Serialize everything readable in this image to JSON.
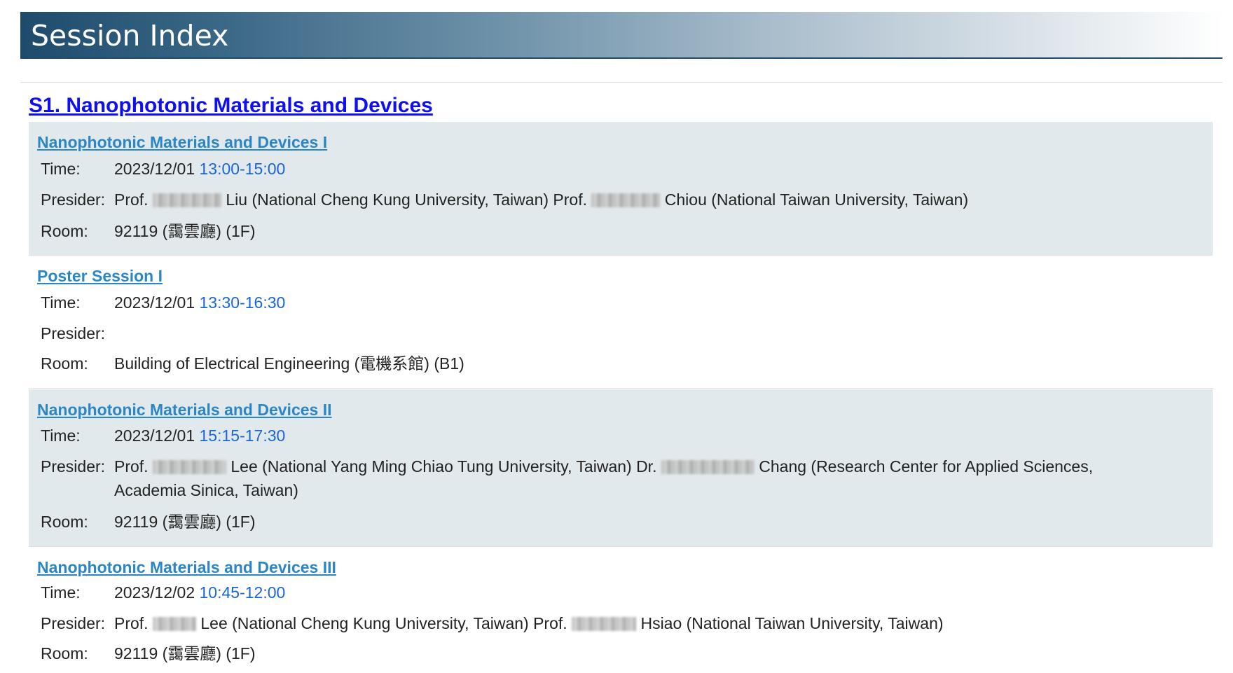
{
  "header": {
    "title": "Session Index"
  },
  "section": {
    "title": "S1. Nanophotonic Materials and Devices"
  },
  "labels": {
    "time": "Time:",
    "presider": "Presider:",
    "room": "Room:"
  },
  "sessions": [
    {
      "title": "Nanophotonic Materials and Devices I",
      "date": "2023/12/01",
      "time": "13:00-15:00",
      "presider": {
        "p1_title": "Prof.",
        "p1_mid": "Liu (National Cheng Kung University, Taiwan) Prof.",
        "p1_end": "Chiou (National Taiwan University, Taiwan)"
      },
      "room": "92119 (靄雲廳) (1F)"
    },
    {
      "title": "Poster Session I",
      "date": "2023/12/01",
      "time": "13:30-16:30",
      "presider": {},
      "room": "Building of Electrical Engineering (電機系館) (B1)"
    },
    {
      "title": "Nanophotonic Materials and Devices II",
      "date": "2023/12/01",
      "time": "15:15-17:30",
      "presider": {
        "p1_title": "Prof.",
        "p1_mid": "Lee (National Yang Ming Chiao Tung University, Taiwan) Dr.",
        "p1_end": "Chang (Research Center for Applied Sciences, Academia Sinica, Taiwan)"
      },
      "room": "92119 (靄雲廳) (1F)"
    },
    {
      "title": "Nanophotonic Materials and Devices III",
      "date": "2023/12/02",
      "time": "10:45-12:00",
      "presider": {
        "p1_title": "Prof.",
        "p1_mid": "Lee (National Cheng Kung University, Taiwan) Prof.",
        "p1_end": "Hsiao (National Taiwan University, Taiwan)"
      },
      "room": "92119 (靄雲廳) (1F)"
    }
  ]
}
